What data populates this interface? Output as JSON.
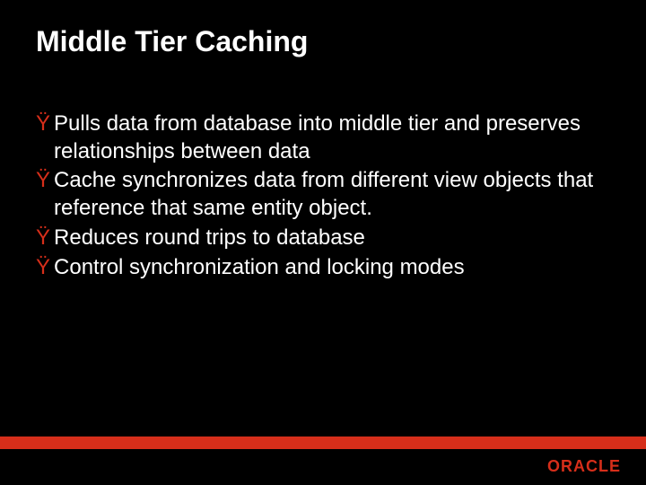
{
  "slide": {
    "title": "Middle Tier Caching",
    "bullets": [
      {
        "marker": "Ÿ",
        "text": "Pulls data from database into middle tier and preserves relationships between data"
      },
      {
        "marker": "Ÿ",
        "text": "Cache synchronizes data from different view objects that reference that same entity object."
      },
      {
        "marker": "Ÿ",
        "text": "Reduces round trips to database"
      },
      {
        "marker": "Ÿ",
        "text": "Control synchronization and locking modes"
      }
    ]
  },
  "brand": {
    "name": "ORACLE"
  },
  "colors": {
    "background": "#000000",
    "text": "#ffffff",
    "accent": "#d62e1a"
  }
}
